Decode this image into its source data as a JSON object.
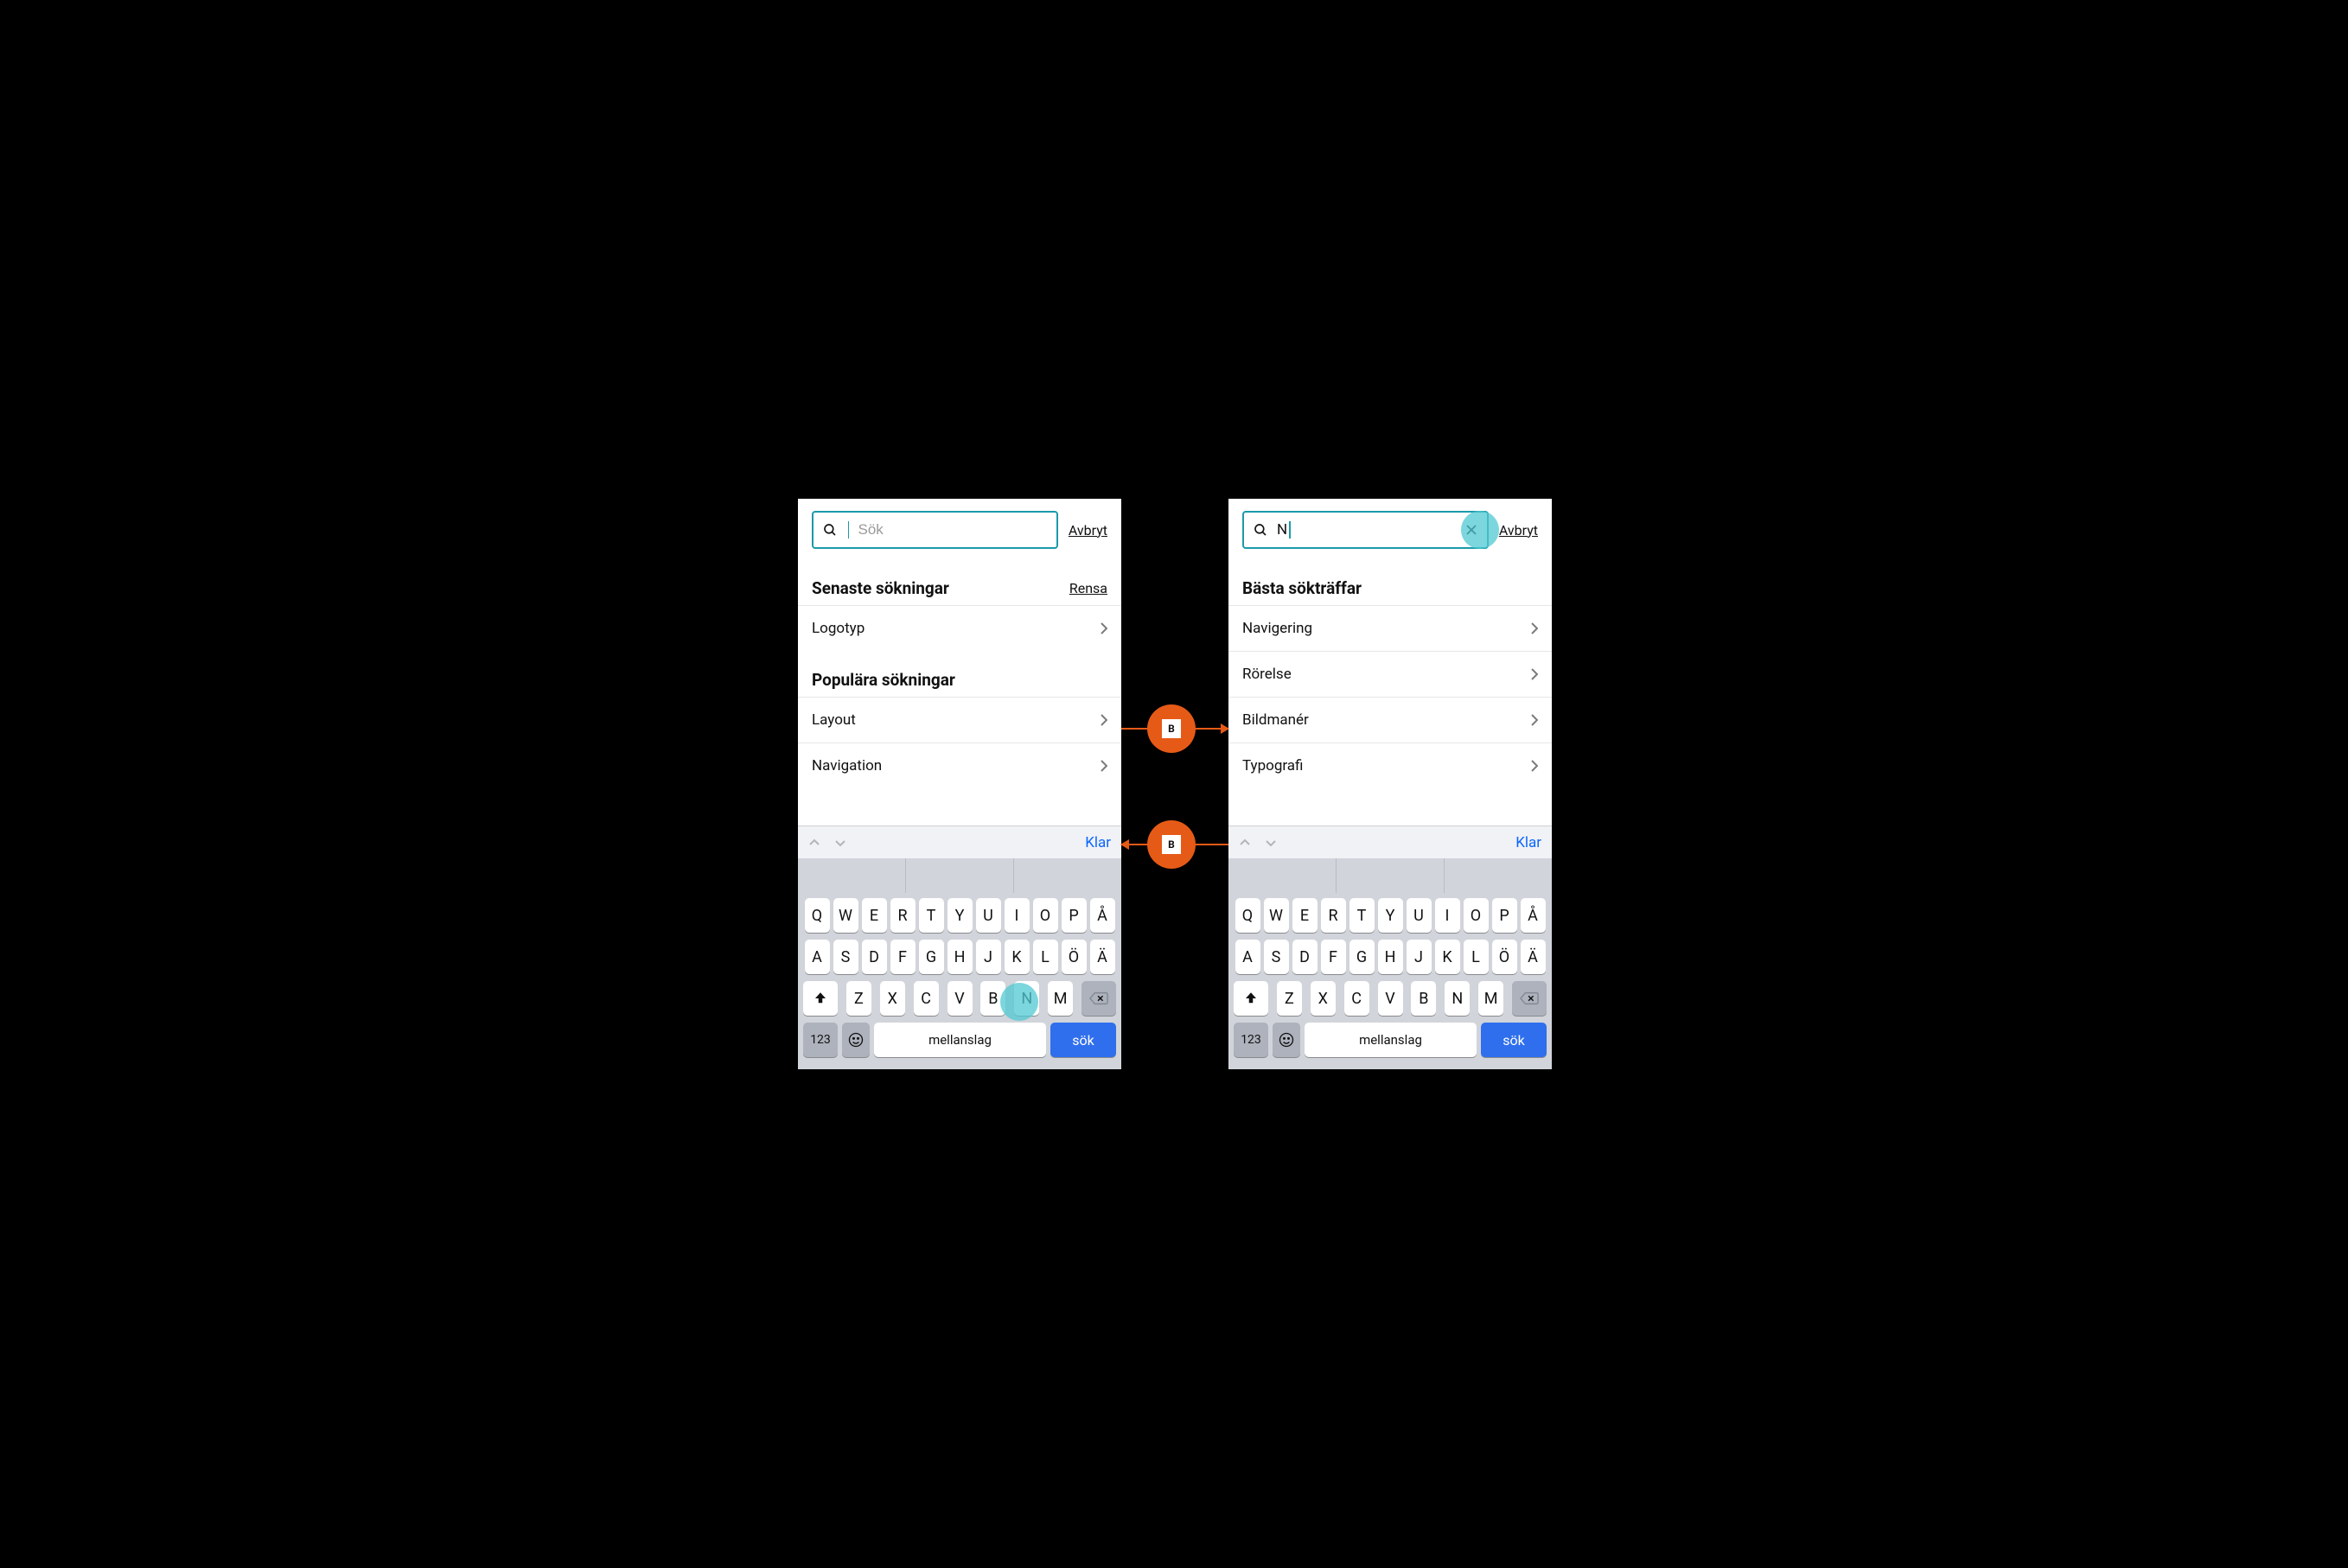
{
  "colors": {
    "accent": "#1b9aaa",
    "badge": "#e65a17",
    "ios_blue": "#0a66ff",
    "search_btn": "#2f6fed"
  },
  "waypoints": {
    "top_label": "B",
    "bottom_label": "B"
  },
  "left": {
    "search": {
      "placeholder": "Sök",
      "value": ""
    },
    "cancel": "Avbryt",
    "sections": [
      {
        "title": "Senaste sökningar",
        "action": "Rensa",
        "items": [
          "Logotyp"
        ]
      },
      {
        "title": "Populära sökningar",
        "action": null,
        "items": [
          "Layout",
          "Navigation"
        ]
      }
    ],
    "accessory_done": "Klar",
    "touch_target_key": "N"
  },
  "right": {
    "search": {
      "placeholder": "Sök",
      "value": "N"
    },
    "cancel": "Avbryt",
    "sections": [
      {
        "title": "Bästa sökträffar",
        "action": null,
        "items": [
          "Navigering",
          "Rörelse",
          "Bildmanér",
          "Typografi"
        ]
      }
    ],
    "accessory_done": "Klar",
    "touch_target": "clear-x"
  },
  "keyboard": {
    "rows": [
      [
        "Q",
        "W",
        "E",
        "R",
        "T",
        "Y",
        "U",
        "I",
        "O",
        "P",
        "Å"
      ],
      [
        "A",
        "S",
        "D",
        "F",
        "G",
        "H",
        "J",
        "K",
        "L",
        "Ö",
        "Ä"
      ],
      [
        "Z",
        "X",
        "C",
        "V",
        "B",
        "N",
        "M"
      ]
    ],
    "num_label": "123",
    "space_label": "mellanslag",
    "search_label": "sök"
  }
}
